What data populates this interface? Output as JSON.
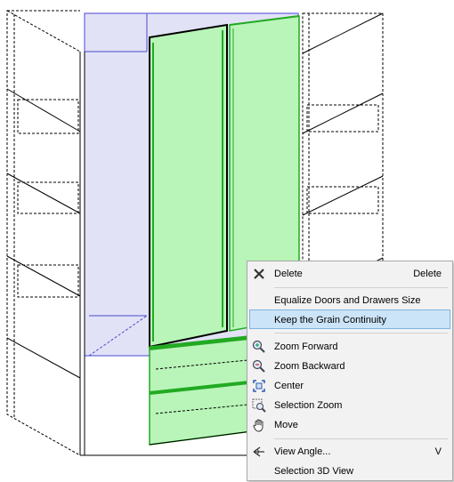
{
  "context_menu": {
    "items": [
      {
        "label": "Delete",
        "shortcut": "Delete",
        "icon": "delete-x-icon"
      },
      {
        "label": "Equalize Doors and Drawers Size",
        "shortcut": "",
        "icon": ""
      },
      {
        "label": "Keep the Grain Continuity",
        "shortcut": "",
        "icon": "",
        "highlighted": true
      },
      {
        "label": "Zoom Forward",
        "shortcut": "",
        "icon": "zoom-in-icon"
      },
      {
        "label": "Zoom Backward",
        "shortcut": "",
        "icon": "zoom-out-icon"
      },
      {
        "label": "Center",
        "shortcut": "",
        "icon": "center-icon"
      },
      {
        "label": "Selection Zoom",
        "shortcut": "",
        "icon": "selection-zoom-icon"
      },
      {
        "label": "Move",
        "shortcut": "",
        "icon": "hand-icon"
      },
      {
        "label": "View Angle...",
        "shortcut": "V",
        "icon": "view-angle-icon"
      },
      {
        "label": "Selection 3D View",
        "shortcut": "",
        "icon": ""
      }
    ]
  },
  "colors": {
    "selection_fill": "#b9f5b9",
    "selection_stroke": "#22aa22",
    "glass_fill": "#e2e2f7",
    "highlight": "#cce4f7",
    "arrow": "#e8433c"
  }
}
